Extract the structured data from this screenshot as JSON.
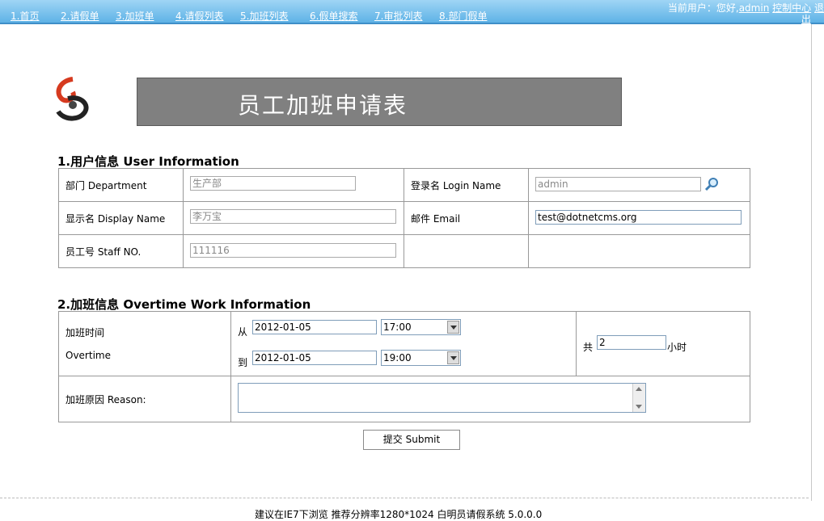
{
  "nav": [
    "1.首页",
    "2.请假单",
    "3.加班单",
    "4.请假列表",
    "5.加班列表",
    "6.假单搜索",
    "7.审批列表",
    "8.部门假单"
  ],
  "user": {
    "prefix": "当前用户：您好,",
    "name": "admin",
    "control": "控制中心",
    "logout_part1": "退",
    "logout_part2": "出"
  },
  "banner_title": "员工加班申请表",
  "section1": {
    "title": "1.用户信息  User Information",
    "department_label": "部门 Department",
    "department_value": "生产部",
    "login_label": "登录名 Login Name",
    "login_value": "admin",
    "display_label": "显示名 Display Name",
    "display_value": "李万宝",
    "email_label": "邮件 Email",
    "email_value": "test@dotnetcms.org",
    "staff_label": "员工号 Staff NO.",
    "staff_value": "111116"
  },
  "section2": {
    "title": "2.加班信息  Overtime Work Information",
    "time_label": "加班时间",
    "time_label_en": "Overtime",
    "from_label": "从",
    "from_date": "2012-01-05",
    "from_time": "17:00",
    "to_label": "到",
    "to_date": "2012-01-05",
    "to_time": "19:00",
    "total_prefix": "共",
    "total_hours": "2",
    "hours_unit": "小时",
    "reason_label": "加班原因 Reason:"
  },
  "submit_label": "提交 Submit",
  "footer_text": "建议在IE7下浏览  推荐分辨率1280*1024  白明员请假系统  5.0.0.0",
  "colors": {
    "topbar": "#5eb2e6",
    "banner": "#808080"
  }
}
